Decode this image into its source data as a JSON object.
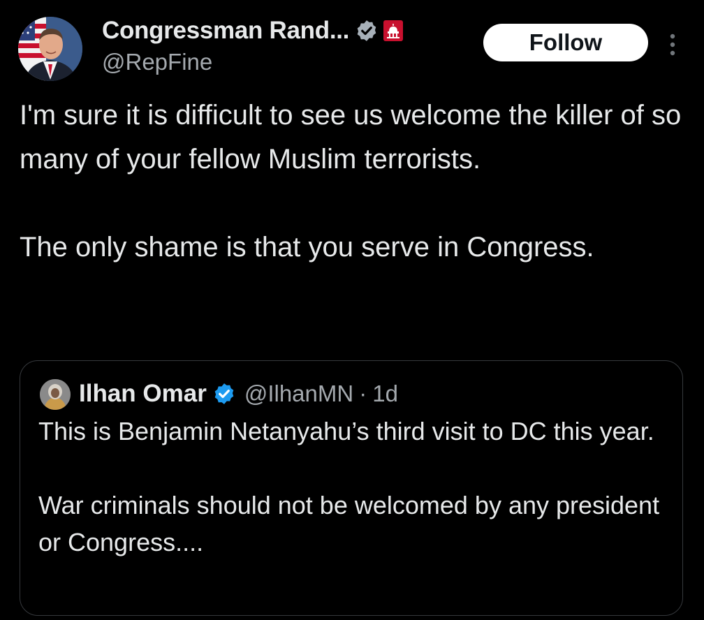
{
  "tweet": {
    "author": {
      "display_name": "Congressman Rand...",
      "handle": "@RepFine",
      "avatar_icon": "profile-photo",
      "verified_icon": "verified-badge-icon",
      "affiliation_icon": "capitol-dome-icon"
    },
    "follow_label": "Follow",
    "more_icon": "more-vertical-icon",
    "text": "I'm sure it is difficult to see us welcome the killer of so many of your fellow Muslim terrorists.\n\nThe only shame is that you serve in Congress.",
    "quote": {
      "display_name": "Ilhan Omar",
      "handle": "@IlhanMN",
      "separator": "·",
      "time": "1d",
      "text": "This is Benjamin Netanyahu’s third visit to DC this year.\n\nWar criminals should not be welcomed by any president or Congress...."
    }
  },
  "colors": {
    "background": "#000000",
    "primary_text": "#e7e9ea",
    "secondary_text": "#a4a9ae",
    "verified_blue": "#1d9bf0",
    "follow_bg": "#ffffff",
    "border": "#36393d",
    "affiliation_red": "#c8102e"
  }
}
